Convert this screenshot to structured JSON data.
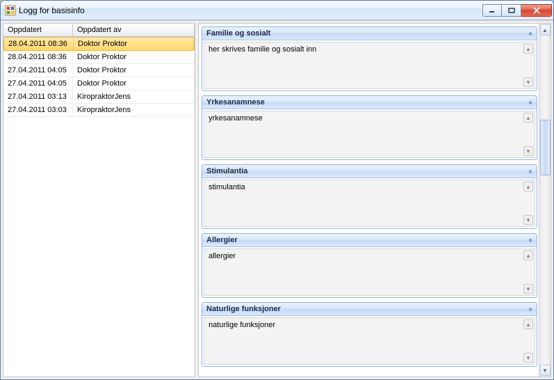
{
  "window": {
    "title": "Logg for basisinfo"
  },
  "table": {
    "headers": {
      "updated": "Oppdatert",
      "updated_by": "Oppdatert av"
    },
    "rows": [
      {
        "updated": "28.04.2011 08:36",
        "by": "Doktor Proktor",
        "selected": true
      },
      {
        "updated": "28.04.2011 08:36",
        "by": "Doktor Proktor",
        "selected": false
      },
      {
        "updated": "27.04.2011 04:05",
        "by": "Doktor Proktor",
        "selected": false
      },
      {
        "updated": "27.04.2011 04:05",
        "by": "Doktor Proktor",
        "selected": false
      },
      {
        "updated": "27.04.2011 03:13",
        "by": "KiropraktorJens",
        "selected": false
      },
      {
        "updated": "27.04.2011 03:03",
        "by": "KiropraktorJens",
        "selected": false
      }
    ]
  },
  "panels": [
    {
      "title": "Familie og sosialt",
      "content": "her skrives familie og sosialt inn"
    },
    {
      "title": "Yrkesanamnese",
      "content": "yrkesanamnese"
    },
    {
      "title": "Stimulantia",
      "content": "stimulantia"
    },
    {
      "title": "Allergier",
      "content": "allergier"
    },
    {
      "title": "Naturlige funksjoner",
      "content": "naturlige funksjoner"
    }
  ]
}
